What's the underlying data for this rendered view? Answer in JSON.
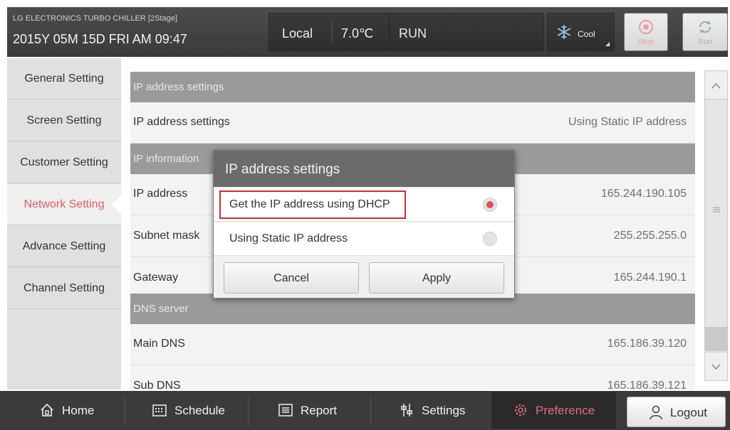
{
  "header": {
    "title": "LG ELECTRONICS TURBO CHILLER [2Stage]",
    "datetime": "2015Y 05M 15D  FRI AM 09:47",
    "control_mode": "Local",
    "temperature": "7.0℃",
    "status": "RUN",
    "operation_mode": "Cool",
    "stop_label": "Stop",
    "run_label": "Run",
    "colors": {
      "stop": "#e7a0a0",
      "run": "#9fbf9f"
    }
  },
  "sidebar": {
    "items": [
      {
        "label": "General Setting"
      },
      {
        "label": "Screen Setting"
      },
      {
        "label": "Customer Setting"
      },
      {
        "label": "Network Setting",
        "active": true
      },
      {
        "label": "Advance Setting"
      },
      {
        "label": "Channel Setting"
      }
    ],
    "active_color": "#e35a6a"
  },
  "main": {
    "sections": {
      "ip_settings_header": "IP address settings",
      "ip_settings_label": "IP address settings",
      "ip_settings_value": "Using Static IP address",
      "ip_info_header": "IP information",
      "ip_address_label": "IP address",
      "ip_address_value": "165.244.190.105",
      "subnet_label": "Subnet mask",
      "subnet_value": "255.255.255.0",
      "gateway_label": "Gateway",
      "gateway_value": "165.244.190.1",
      "dns_header": "DNS server",
      "main_dns_label": "Main DNS",
      "main_dns_value": "165.186.39.120",
      "sub_dns_label": "Sub DNS",
      "sub_dns_value": "165.186.39.121"
    }
  },
  "dialog": {
    "title": "IP address settings",
    "options": [
      {
        "label": "Get the IP address using DHCP",
        "selected": true
      },
      {
        "label": "Using Static IP address",
        "selected": false
      }
    ],
    "cancel_label": "Cancel",
    "apply_label": "Apply",
    "highlight_color": "#d9262d"
  },
  "nav": {
    "items": [
      {
        "label": "Home",
        "icon": "home-icon"
      },
      {
        "label": "Schedule",
        "icon": "calendar-icon"
      },
      {
        "label": "Report",
        "icon": "report-icon"
      },
      {
        "label": "Settings",
        "icon": "settings-icon"
      },
      {
        "label": "Preference",
        "icon": "gear-icon",
        "active": true
      }
    ],
    "logout_label": "Logout",
    "active_color": "#e06c7a"
  }
}
